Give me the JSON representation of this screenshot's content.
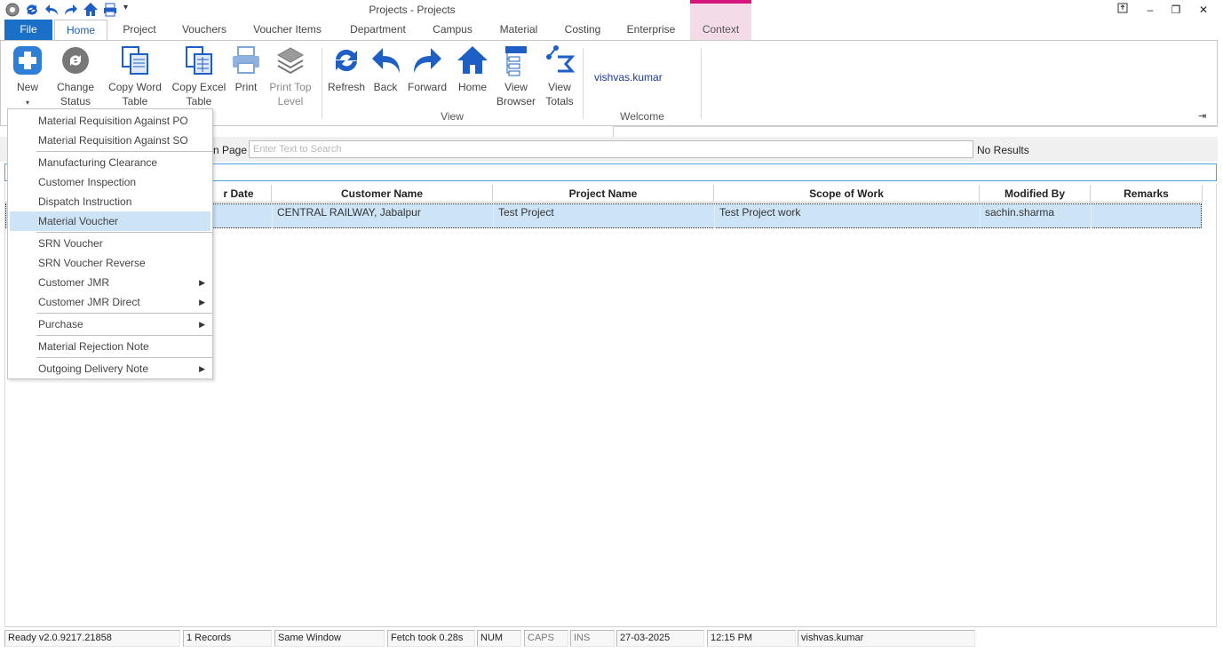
{
  "window": {
    "title": "Projects - Projects"
  },
  "tabs": [
    "File",
    "Home",
    "Project",
    "Vouchers",
    "Voucher Items",
    "Department",
    "Campus",
    "Material",
    "Costing",
    "Enterprise",
    "Context"
  ],
  "ribbon": {
    "new_label": "New",
    "change_status_label": "Change Status",
    "copy_word_label": "Copy Word Table",
    "copy_excel_label": "Copy Excel Table",
    "print_label": "Print",
    "print_top_label": "Print Top Level",
    "refresh_label": "Refresh",
    "back_label": "Back",
    "forward_label": "Forward",
    "home_label": "Home",
    "view_browser_label": "View Browser",
    "view_totals_label": "View Totals",
    "view_group_label": "View",
    "user_name": "vishvas.kumar",
    "welcome_group_label": "Welcome"
  },
  "search": {
    "label": "n Page",
    "placeholder": "Enter Text to Search",
    "results": "No Results"
  },
  "grid": {
    "columns": [
      "r Date",
      "Customer Name",
      "Project Name",
      "Scope of Work",
      "Modified By",
      "Remarks"
    ],
    "rows": [
      {
        "customer": "CENTRAL RAILWAY, Jabalpur",
        "project": "Test Project",
        "scope": "Test Project work",
        "modified_by": "sachin.sharma",
        "remarks": ""
      }
    ]
  },
  "new_menu": {
    "items": [
      {
        "label": "Material Requisition Against PO"
      },
      {
        "label": "Material Requisition Against SO"
      },
      {
        "label": "Manufacturing Clearance"
      },
      {
        "label": "Customer Inspection"
      },
      {
        "label": "Dispatch Instruction"
      },
      {
        "label": "Material Voucher",
        "highlighted": true
      },
      {
        "label": "SRN Voucher"
      },
      {
        "label": "SRN Voucher Reverse"
      },
      {
        "label": "Customer JMR",
        "submenu": true
      },
      {
        "label": "Customer JMR Direct",
        "submenu": true
      },
      {
        "label": "Purchase",
        "submenu": true
      },
      {
        "label": "Material Rejection Note"
      },
      {
        "label": "Outgoing Delivery Note",
        "submenu": true
      }
    ]
  },
  "status": {
    "version": "Ready v2.0.9217.21858",
    "records": "1 Records",
    "window_mode": "Same Window",
    "fetch": "Fetch took 0.28s",
    "num": "NUM",
    "caps": "CAPS",
    "ins": "INS",
    "date": "27-03-2025",
    "time": "12:15 PM",
    "user": "vishvas.kumar"
  },
  "colors": {
    "file_tab": "#1a6fc6",
    "context_accent": "#d6147d",
    "selection": "#cde4f7",
    "filter_border": "#4aa3df"
  }
}
